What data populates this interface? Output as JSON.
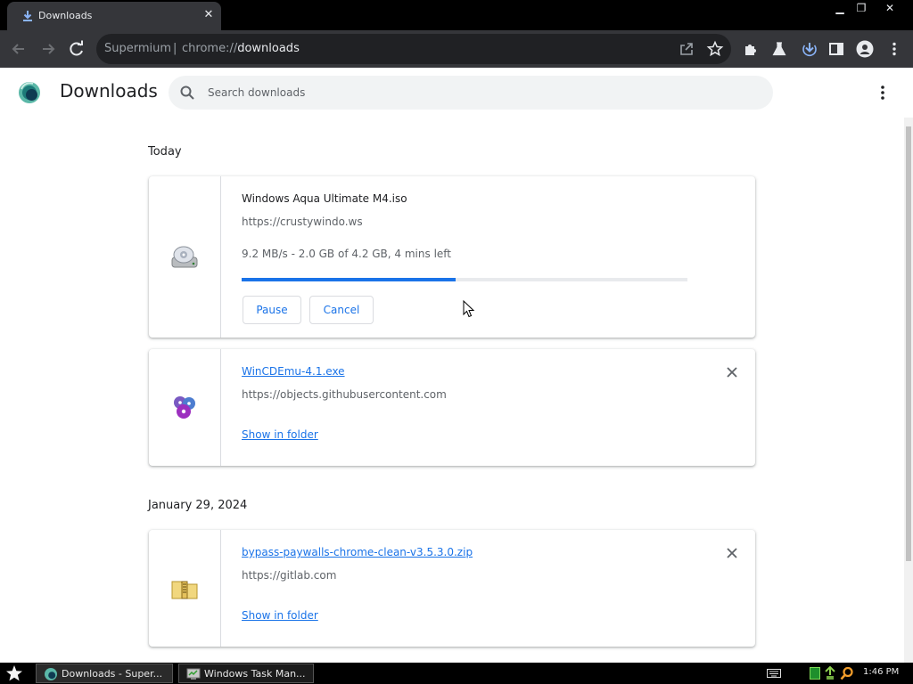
{
  "browser": {
    "tab_title": "Downloads",
    "omnibox_prefix": "Supermium",
    "omnibox_sep": "|",
    "omnibox_scheme": "chrome://",
    "omnibox_host": "downloads",
    "icons": [
      "back-icon",
      "forward-icon",
      "reload-icon",
      "share-icon",
      "star-icon",
      "extensions-icon",
      "labs-icon",
      "downloads-icon",
      "sidepanel-icon",
      "profile-icon",
      "kebab-menu-icon"
    ]
  },
  "page": {
    "title": "Downloads",
    "search_placeholder": "Search downloads"
  },
  "groups": [
    {
      "date": "Today",
      "items": [
        {
          "name": "Windows Aqua Ultimate M4.iso",
          "url": "https://crustywindo.ws",
          "status": "9.2 MB/s - 2.0 GB of 4.2 GB, 4 mins left",
          "progress": 0.48,
          "pause_label": "Pause",
          "cancel_label": "Cancel",
          "icon": "disc-drive-icon"
        },
        {
          "name": "WinCDEmu-4.1.exe",
          "url": "https://objects.githubusercontent.com",
          "action": "Show in folder",
          "icon": "wincdemu-icon"
        }
      ]
    },
    {
      "date": "January 29, 2024",
      "items": [
        {
          "name": "bypass-paywalls-chrome-clean-v3.5.3.0.zip",
          "url": "https://gitlab.com",
          "action": "Show in folder",
          "icon": "zip-folder-icon"
        }
      ]
    }
  ],
  "taskbar": {
    "tasks": [
      {
        "label": "Downloads - Super..."
      },
      {
        "label": "Windows Task Man..."
      }
    ],
    "clock": "1:46 PM"
  },
  "colors": {
    "accent": "#1a73e8",
    "toolbar": "#35363a",
    "progress_track": "#e8eaed"
  }
}
